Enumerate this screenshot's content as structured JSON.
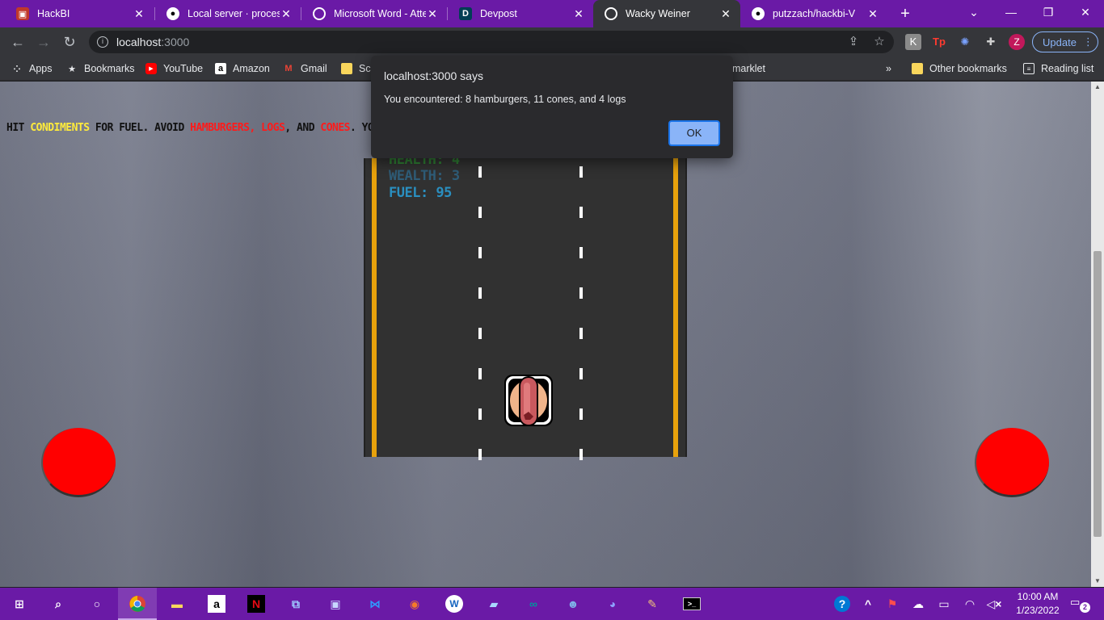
{
  "tabs": [
    {
      "title": "HackBI",
      "icon": "hackbi-icon",
      "active": false
    },
    {
      "title": "Local server · processin",
      "icon": "github-icon",
      "active": false
    },
    {
      "title": "Microsoft Word - Atte",
      "icon": "globe-icon",
      "active": false
    },
    {
      "title": "Devpost",
      "icon": "devpost-icon",
      "active": false
    },
    {
      "title": "Wacky Weiner",
      "icon": "globe-icon",
      "active": true
    },
    {
      "title": "putzzach/hackbi-V",
      "icon": "github-icon",
      "active": false
    }
  ],
  "address_bar": {
    "host": "localhost",
    "port": ":3000"
  },
  "update_label": "Update",
  "profile_initial": "Z",
  "bookmarks": [
    {
      "label": "Apps",
      "icon": "apps-grid-icon"
    },
    {
      "label": "Bookmarks",
      "icon": "star-icon"
    },
    {
      "label": "YouTube",
      "icon": "youtube-icon"
    },
    {
      "label": "Amazon",
      "icon": "amazon-icon"
    },
    {
      "label": "Gmail",
      "icon": "gmail-icon"
    },
    {
      "label": "Scl",
      "icon": "folder-icon"
    },
    {
      "label": "marklet",
      "icon": ""
    }
  ],
  "other_bookmarks": "Other bookmarks",
  "reading_list": "Reading list",
  "chevron": "»",
  "page": {
    "instructions": {
      "p1": "HIT ",
      "condiments": "CONDIMENTS",
      "p2": " FOR FUEL. AVOID ",
      "hamburgers": "HAMBURGERS",
      "sep1": ", ",
      "logs": "LOGS",
      "sep2": ", AND ",
      "cones": "CONES",
      "p3": ". YOU"
    },
    "hud": {
      "health": "HEALTH: 4",
      "wealth": "WEALTH: 3",
      "fuel": "FUEL: 95"
    },
    "colors": {
      "health": "#2e7d32",
      "wealth": "#2f5d78",
      "fuel": "#2a8fc0",
      "road_edge": "#e8a20c",
      "button": "#ff0000"
    }
  },
  "alert": {
    "title": "localhost:3000 says",
    "message": "You encountered: 8 hamburgers, 11 cones, and 4 logs",
    "ok_label": "OK"
  },
  "taskbar": {
    "time": "10:00 AM",
    "date": "1/23/2022",
    "notifications": "2"
  }
}
